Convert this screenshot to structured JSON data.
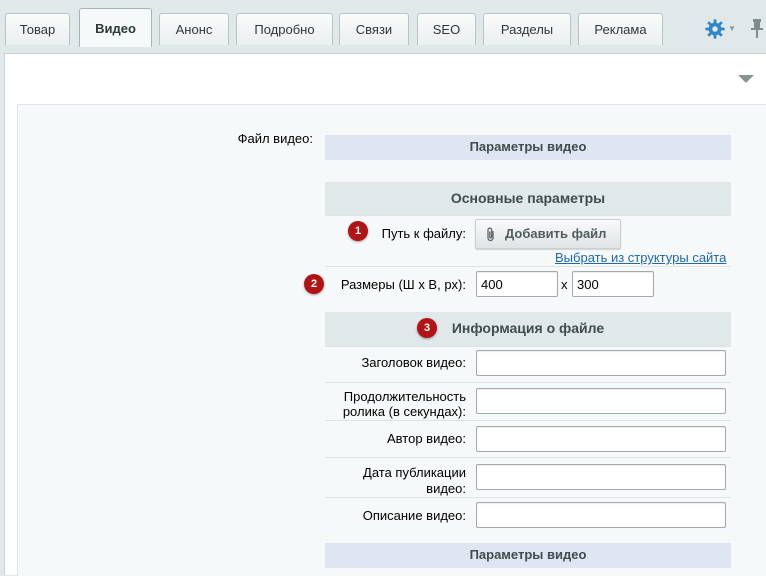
{
  "tabs": [
    {
      "label": "Товар",
      "active": false
    },
    {
      "label": "Видео",
      "active": true
    },
    {
      "label": "Анонс",
      "active": false
    },
    {
      "label": "Подробно",
      "active": false
    },
    {
      "label": "Связи",
      "active": false
    },
    {
      "label": "SEO",
      "active": false
    },
    {
      "label": "Разделы",
      "active": false
    },
    {
      "label": "Реклама",
      "active": false
    }
  ],
  "toolbar": {
    "gear_icon": "gear-icon",
    "pin_icon": "pin-icon",
    "accent": "#2f86c8"
  },
  "form": {
    "file_label": "Файл видео:",
    "params_header": "Параметры видео",
    "main_header": "Основные параметры",
    "path_label": "Путь к файлу:",
    "add_file_label": "Добавить файл",
    "choose_link": "Выбрать из структуры сайта",
    "size_label": "Размеры (Ш х В, px):",
    "width_value": "400",
    "times_sign": "x",
    "height_value": "300",
    "info_header": "Информация о файле",
    "title_label": "Заголовок видео:",
    "title_value": "",
    "duration_label_1": "Продолжительность",
    "duration_label_2": "ролика (в секундах):",
    "duration_value": "",
    "author_label": "Автор видео:",
    "author_value": "",
    "date_label_1": "Дата публикации",
    "date_label_2": "видео:",
    "date_value": "",
    "desc_label": "Описание видео:",
    "desc_value": "",
    "params_header_bottom": "Параметры видео"
  },
  "badges": [
    "1",
    "2",
    "3"
  ],
  "colors": {
    "badge": "#b21314",
    "link": "#2067b0",
    "header_bg": "#e0e8ea",
    "params_bg": "#e0e5f2"
  }
}
